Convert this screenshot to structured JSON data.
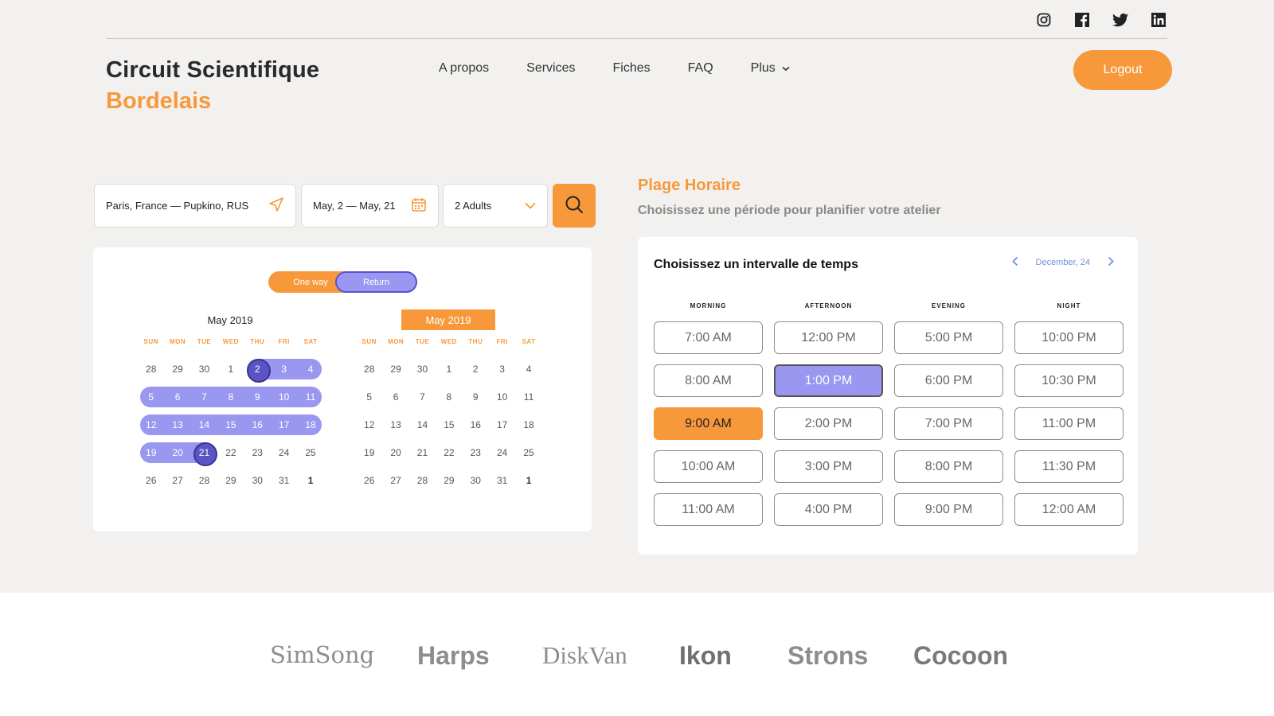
{
  "social": [
    "instagram-icon",
    "facebook-icon",
    "twitter-icon",
    "linkedin-icon"
  ],
  "brand": {
    "line1": "Circuit Scientifique",
    "line2": "Bordelais"
  },
  "nav": {
    "items": [
      "A propos",
      "Services",
      "Fiches",
      "FAQ",
      "Plus"
    ]
  },
  "logout_label": "Logout",
  "search": {
    "route": "Paris, France — Pupkino, RUS",
    "dates": "May, 2 — May, 21",
    "guests": "2 Adults"
  },
  "trip_toggle": {
    "one_way": "One way",
    "return": "Return",
    "active": "Return"
  },
  "calendar": {
    "dow": [
      "SUN",
      "MON",
      "TUE",
      "WED",
      "THU",
      "FRI",
      "SAT"
    ],
    "left": {
      "title": "May 2019",
      "weeks": [
        [
          "28",
          "29",
          "30",
          "1",
          "2",
          "3",
          "4"
        ],
        [
          "5",
          "6",
          "7",
          "8",
          "9",
          "10",
          "11"
        ],
        [
          "12",
          "13",
          "14",
          "15",
          "16",
          "17",
          "18"
        ],
        [
          "19",
          "20",
          "21",
          "22",
          "23",
          "24",
          "25"
        ],
        [
          "26",
          "27",
          "28",
          "29",
          "30",
          "31",
          "1"
        ]
      ]
    },
    "right": {
      "title": "May 2019",
      "weeks": [
        [
          "28",
          "29",
          "30",
          "1",
          "2",
          "3",
          "4"
        ],
        [
          "5",
          "6",
          "7",
          "8",
          "9",
          "10",
          "11"
        ],
        [
          "12",
          "13",
          "14",
          "15",
          "16",
          "17",
          "18"
        ],
        [
          "19",
          "20",
          "21",
          "22",
          "23",
          "24",
          "25"
        ],
        [
          "26",
          "27",
          "28",
          "29",
          "30",
          "31",
          "1"
        ]
      ]
    },
    "range_start": "2",
    "range_end": "21"
  },
  "plage": {
    "title": "Plage Horaire",
    "subtitle": "Choisissez une période pour planifier votre atelier",
    "card_title": "Choisissez un intervalle de temps",
    "month": "December, 24",
    "columns": [
      {
        "name": "MORNING",
        "slots": [
          "7:00 AM",
          "8:00 AM",
          "9:00 AM",
          "10:00 AM",
          "11:00 AM"
        ]
      },
      {
        "name": "AFTERNOON",
        "slots": [
          "12:00 PM",
          "1:00 PM",
          "2:00 PM",
          "3:00 PM",
          "4:00 PM"
        ]
      },
      {
        "name": "EVENING",
        "slots": [
          "5:00 PM",
          "6:00 PM",
          "7:00 PM",
          "8:00 PM",
          "9:00 PM"
        ]
      },
      {
        "name": "NIGHT",
        "slots": [
          "10:00 PM",
          "10:30 PM",
          "11:00 PM",
          "11:30 PM",
          "12:00 AM"
        ]
      }
    ],
    "selected_blue": "1:00 PM",
    "selected_orange": "9:00 AM"
  },
  "logos": [
    "SimSong",
    "Harps",
    "DiskVan",
    "Ikon",
    "Strons",
    "Cocoon"
  ],
  "colors": {
    "accent": "#f7993b",
    "range": "#9a97f0",
    "range_endpoint": "#5b54c4",
    "nav_blue": "#6f8fe0"
  }
}
